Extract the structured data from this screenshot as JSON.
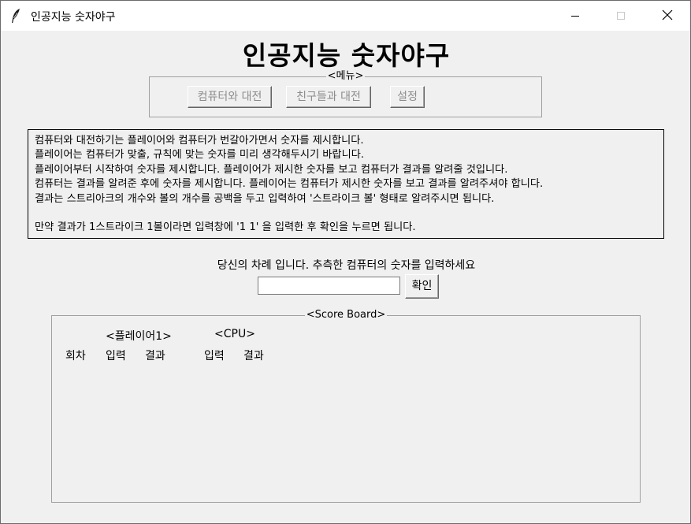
{
  "window": {
    "title": "인공지능 숫자야구",
    "app_icon": "feather-icon",
    "controls": {
      "minimize": "minimize-icon",
      "maximize": "maximize-icon",
      "close": "close-icon"
    }
  },
  "header": {
    "title": "인공지능 숫자야구"
  },
  "menu": {
    "legend": "<메뉴>",
    "buttons": {
      "vs_computer": "컴퓨터와 대전",
      "vs_friends": "친구들과 대전",
      "settings": "설정"
    }
  },
  "instructions": {
    "lines": [
      "컴퓨터와 대전하기는 플레이어와 컴퓨터가 번갈아가면서 숫자를 제시합니다.",
      "플레이어는 컴퓨터가 맞출, 규칙에 맞는 숫자를 미리 생각해두시기 바랍니다.",
      "플레이어부터 시작하여 숫자를 제시합니다. 플레이어가 제시한 숫자를 보고 컴퓨터가 결과를 알려줄 것입니다.",
      "컴퓨터는 결과를 알려준 후에 숫자를 제시합니다. 플레이어는 컴퓨터가 제시한 숫자를 보고 결과를 알려주셔야 합니다.",
      "결과는 스트리아크의 개수와 볼의 개수를 공백을 두고 입력하여 '스트라이크 볼' 형태로 알려주시면 됩니다.",
      "",
      "만약 결과가 1스트라이크 1볼이라면 입력창에 '1 1' 을 입력한 후 확인을 누르면 됩니다."
    ]
  },
  "turn": {
    "prompt": "당신의 차례 입니다. 추측한 컴퓨터의 숫자를 입력하세요",
    "input_value": "",
    "confirm_label": "확인"
  },
  "scoreboard": {
    "legend": "<Score Board>",
    "player_header": "<플레이어1>",
    "cpu_header": "<CPU>",
    "columns": {
      "round": "회차",
      "player_input": "입력",
      "player_result": "결과",
      "cpu_input": "입력",
      "cpu_result": "결과"
    }
  }
}
